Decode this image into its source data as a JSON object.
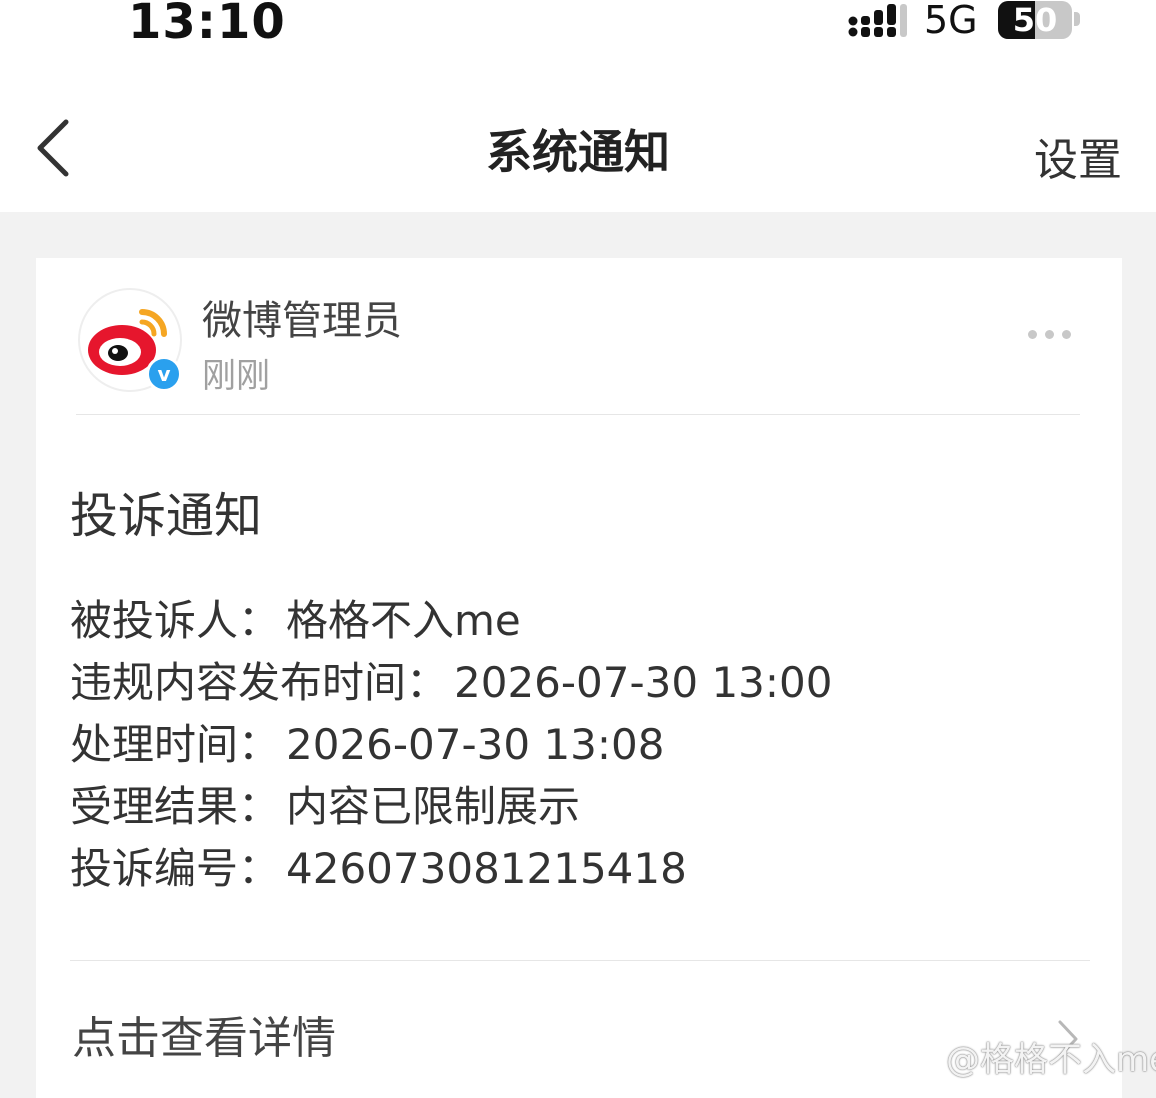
{
  "status_bar": {
    "time": "13:10",
    "network": "5G",
    "battery": "50",
    "battery_level": 0.5
  },
  "nav": {
    "title": "系统通知",
    "settings_label": "设置"
  },
  "message": {
    "sender": "微博管理员",
    "time": "刚刚",
    "verified_mark": "v",
    "notice_title": "投诉通知",
    "fields": [
      {
        "label": "被投诉人：",
        "value": "格格不入me"
      },
      {
        "label": "违规内容发布时间：",
        "value": "2026-07-30 13:00"
      },
      {
        "label": "处理时间：",
        "value": "2026-07-30 13:08"
      },
      {
        "label": "受理结果：",
        "value": "内容已限制展示"
      },
      {
        "label": "投诉编号：",
        "value": "426073081215418"
      }
    ],
    "detail_link": "点击查看详情"
  },
  "watermark": {
    "text": "@格格不入me"
  },
  "colors": {
    "page_bg": "#f2f2f2",
    "card_bg": "#ffffff",
    "weibo_red": "#e6162d",
    "weibo_orange": "#f5a623",
    "verified_blue": "#2aa0ee"
  }
}
